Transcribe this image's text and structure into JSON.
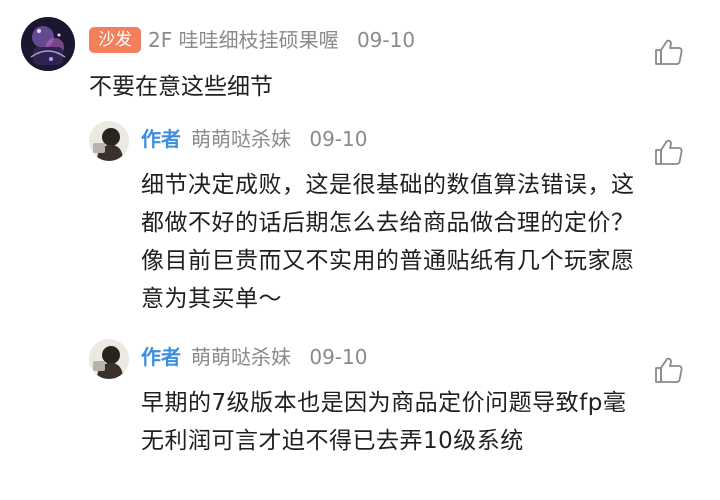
{
  "main_comment": {
    "floor_badge": "沙发",
    "floor": "2F",
    "username": "哇哇细枝挂硕果喔",
    "date": "09-10",
    "text": "不要在意这些细节",
    "avatar_icon": "avatar-icon",
    "like_icon": "thumbs-up-icon"
  },
  "replies": [
    {
      "author_tag": "作者",
      "username": "萌萌哒杀妹",
      "date": "09-10",
      "text": "细节决定成败，这是很基础的数值算法错误，这都做不好的话后期怎么去给商品做合理的定价？像目前巨贵而又不实用的普通贴纸有几个玩家愿意为其买单～",
      "like_icon": "thumbs-up-icon"
    },
    {
      "author_tag": "作者",
      "username": "萌萌哒杀妹",
      "date": "09-10",
      "text": "早期的7级版本也是因为商品定价问题导致fp毫无利润可言才迫不得已去弄10级系统",
      "like_icon": "thumbs-up-icon"
    }
  ],
  "colors": {
    "badge": "#f47f5d",
    "author_tag": "#3b8de0",
    "meta": "#8a8a8a",
    "text": "#1f1f1f"
  }
}
